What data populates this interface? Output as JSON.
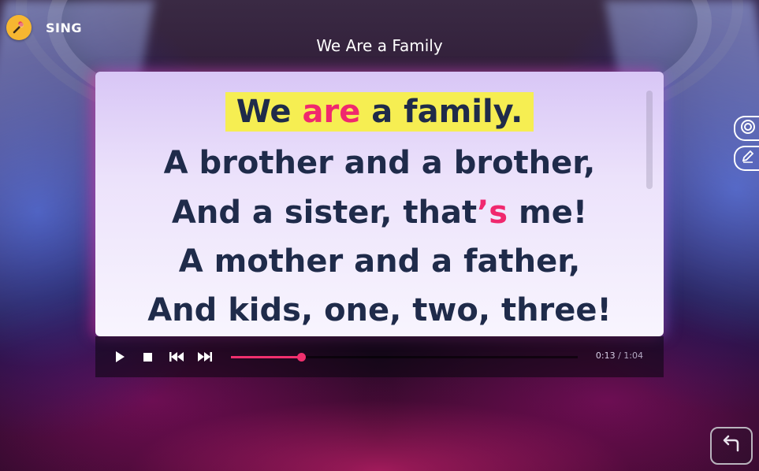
{
  "header": {
    "mode_label": "SING",
    "mode_icon": "microphone-icon",
    "song_title": "We Are a Family"
  },
  "lyrics": {
    "current_line": {
      "before": "We ",
      "highlight": "are",
      "after": " a family."
    },
    "line2": "A brother and a brother,",
    "line3": {
      "before": "And a sister, that",
      "highlight": "’s",
      "after": " me!"
    },
    "line4": "A mother and a father,",
    "line5": "And kids, one, two, three!"
  },
  "player": {
    "current_time": "0:13",
    "separator": " / ",
    "total_time": "1:04",
    "progress": 0.203,
    "controls": [
      "play-icon",
      "stop-icon",
      "previous-icon",
      "next-icon"
    ]
  },
  "side_tools": [
    "target-icon",
    "pencil-icon"
  ],
  "footer": {
    "back_icon": "back-arrow-icon"
  },
  "colors": {
    "highlight_text": "#f0286e",
    "highlight_bg": "#f6ee52",
    "lyric_text": "#1f2b4a",
    "badge": "#f7b731"
  }
}
